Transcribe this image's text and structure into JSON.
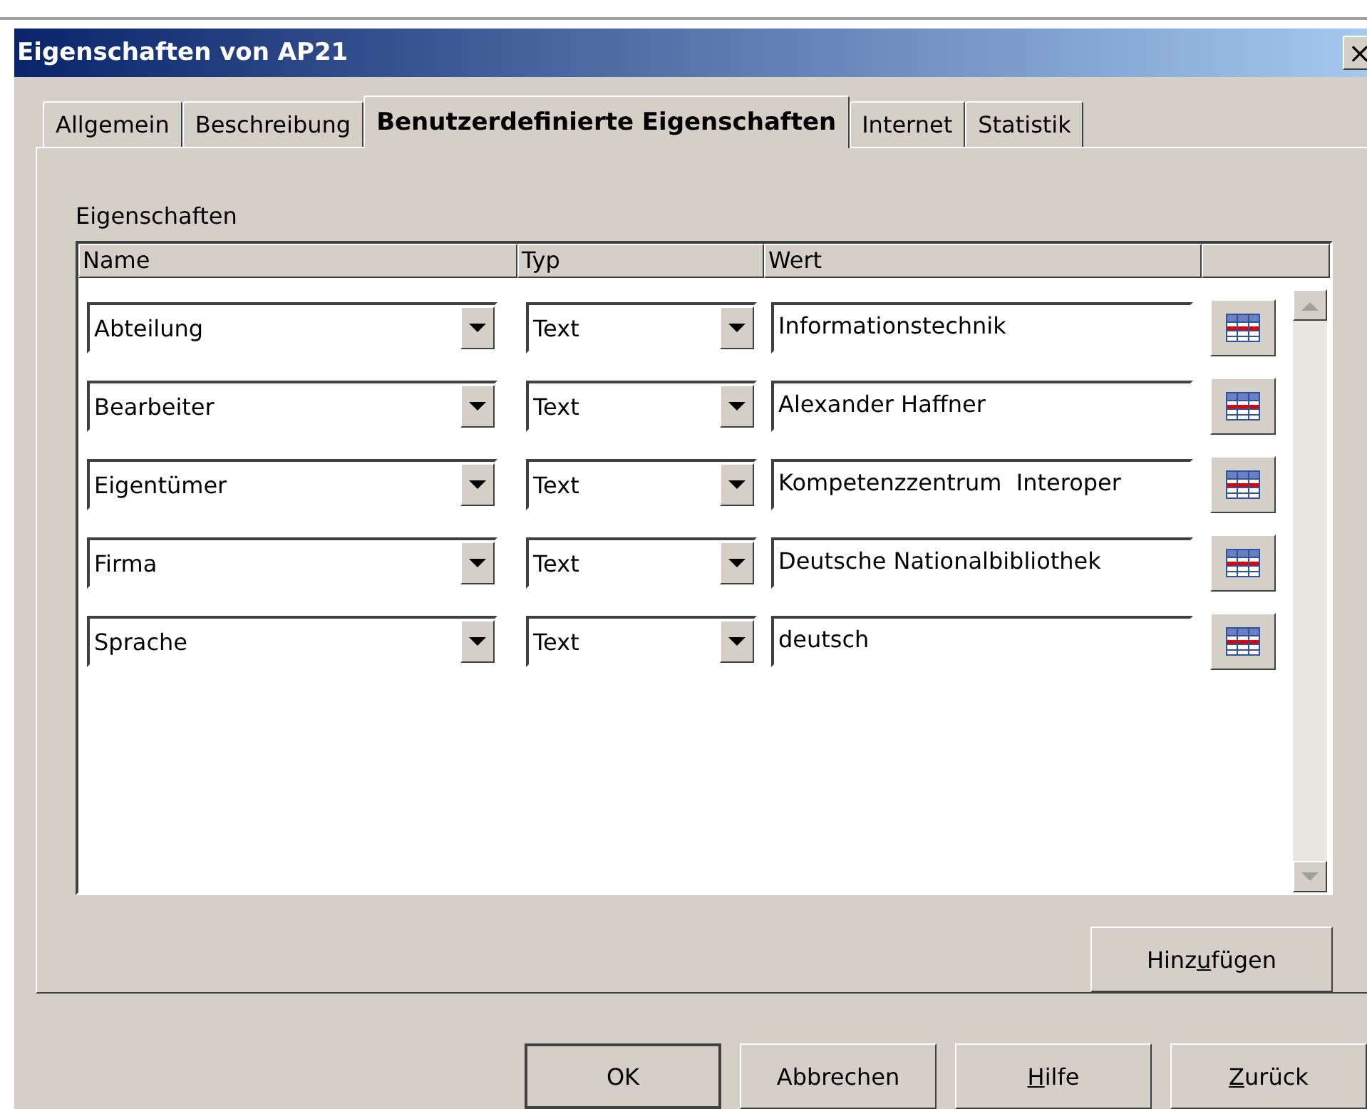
{
  "window": {
    "title": "Eigenschaften von AP21",
    "close": "×"
  },
  "tabs": [
    {
      "label": "Allgemein",
      "selected": false
    },
    {
      "label": "Beschreibung",
      "selected": false
    },
    {
      "label": "Benutzerdefinierte Eigenschaften",
      "selected": true
    },
    {
      "label": "Internet",
      "selected": false
    },
    {
      "label": "Statistik",
      "selected": false
    }
  ],
  "group_label": "Eigenschaften",
  "table": {
    "columns": [
      "Name",
      "Typ",
      "Wert"
    ],
    "rows": [
      {
        "name": "Abteilung",
        "type": "Text",
        "value": "Informationstechnik"
      },
      {
        "name": "Bearbeiter",
        "type": "Text",
        "value": "Alexander Haffner"
      },
      {
        "name": "Eigentümer",
        "type": "Text",
        "value": "Kompetenzzentrum  Interoper"
      },
      {
        "name": "Firma",
        "type": "Text",
        "value": "Deutsche Nationalbibliothek"
      },
      {
        "name": "Sprache",
        "type": "Text",
        "value": "deutsch"
      }
    ]
  },
  "add_button": {
    "before": "Hinz",
    "key": "u",
    "after": "fügen"
  },
  "buttons": [
    {
      "before": "OK",
      "default": true
    },
    {
      "before": "Abbrechen",
      "default": false
    },
    {
      "key": "H",
      "after": "ilfe",
      "default": false
    },
    {
      "key": "Z",
      "after": "urück",
      "default": false
    }
  ]
}
